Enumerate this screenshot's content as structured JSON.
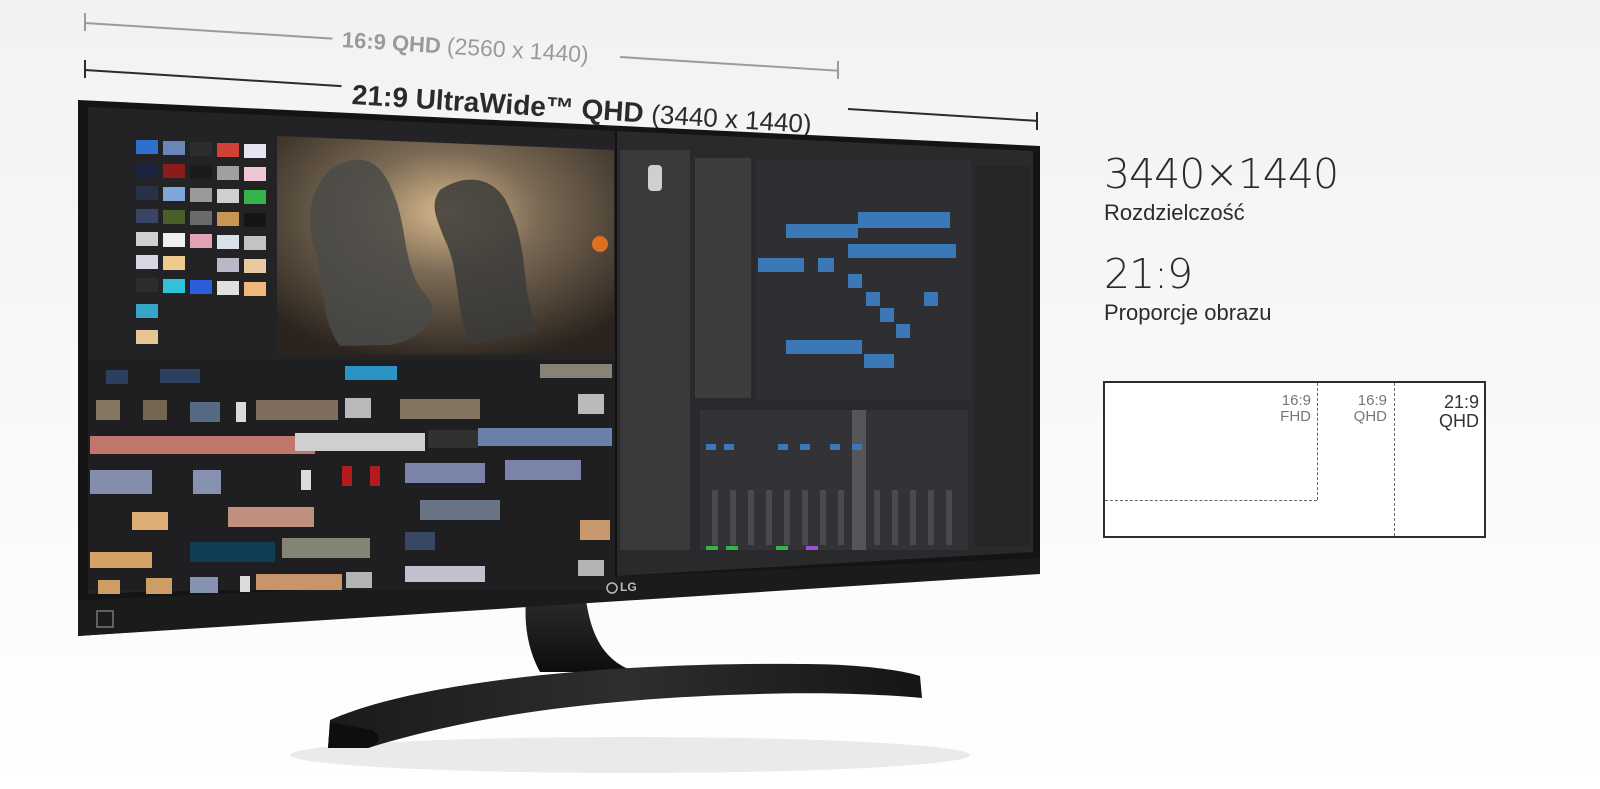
{
  "dimension_labels": {
    "qhd_16_9": {
      "ratio": "16:9 QHD",
      "resolution": "(2560 x 1440)"
    },
    "qhd_21_9": {
      "ratio": "21:9 UltraWide™ QHD",
      "resolution": "(3440 x 1440)"
    }
  },
  "specs": {
    "resolution_value": "3440×1440",
    "resolution_caption": "Rozdzielczość",
    "aspect_value": "21:9",
    "aspect_caption": "Proporcje obrazu"
  },
  "ratio_diagram": {
    "fhd_16_9": {
      "line1": "16:9",
      "line2": "FHD"
    },
    "qhd_16_9": {
      "line1": "16:9",
      "line2": "QHD"
    },
    "qhd_21_9": {
      "line1": "21:9",
      "line2": "QHD"
    }
  },
  "monitor": {
    "brand": "LG"
  }
}
